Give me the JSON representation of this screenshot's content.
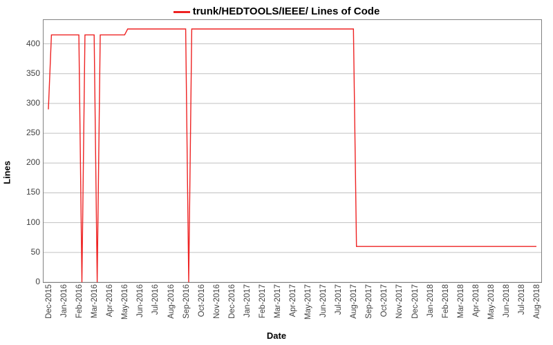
{
  "chart_data": {
    "type": "line",
    "title": "trunk/HEDTOOLS/IEEE/ Lines of Code",
    "xlabel": "Date",
    "ylabel": "Lines",
    "y_ticks": [
      0,
      50,
      100,
      150,
      200,
      250,
      300,
      350,
      400
    ],
    "ylim": [
      0,
      440
    ],
    "x_categories": [
      "Dec-2015",
      "Jan-2016",
      "Feb-2016",
      "Mar-2016",
      "Apr-2016",
      "May-2016",
      "Jun-2016",
      "Jul-2016",
      "Aug-2016",
      "Sep-2016",
      "Oct-2016",
      "Nov-2016",
      "Dec-2016",
      "Jan-2017",
      "Feb-2017",
      "Mar-2017",
      "Apr-2017",
      "May-2017",
      "Jun-2017",
      "Jul-2017",
      "Aug-2017",
      "Sep-2017",
      "Oct-2017",
      "Nov-2017",
      "Dec-2017",
      "Jan-2018",
      "Feb-2018",
      "Mar-2018",
      "Apr-2018",
      "May-2018",
      "Jun-2018",
      "Jul-2018",
      "Aug-2018"
    ],
    "series": [
      {
        "name": "Lines of Code",
        "color": "#ee2222",
        "points": [
          {
            "x": "Dec-2015",
            "y": 290
          },
          {
            "x": "Dec-2015",
            "y": 415
          },
          {
            "x": "Feb-2016",
            "y": 415
          },
          {
            "x": "Feb-2016",
            "y": 0
          },
          {
            "x": "Feb-2016",
            "y": 415
          },
          {
            "x": "Mar-2016",
            "y": 415
          },
          {
            "x": "Mar-2016",
            "y": 0
          },
          {
            "x": "Mar-2016",
            "y": 415
          },
          {
            "x": "May-2016",
            "y": 415
          },
          {
            "x": "May-2016",
            "y": 425
          },
          {
            "x": "Sep-2016",
            "y": 425
          },
          {
            "x": "Sep-2016",
            "y": 0
          },
          {
            "x": "Sep-2016",
            "y": 425
          },
          {
            "x": "Aug-2017",
            "y": 425
          },
          {
            "x": "Aug-2017",
            "y": 60
          },
          {
            "x": "Aug-2018",
            "y": 60
          }
        ]
      }
    ]
  }
}
